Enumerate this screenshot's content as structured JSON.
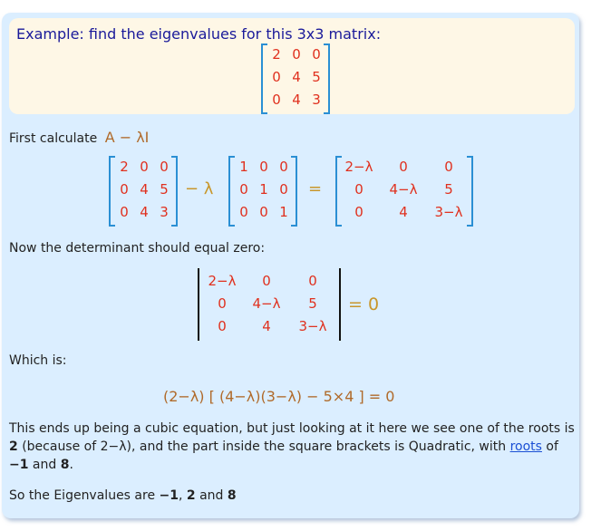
{
  "example": {
    "title": "Example: find the eigenvalues for this 3x3 matrix:",
    "matrix": [
      [
        "2",
        "0",
        "0"
      ],
      [
        "0",
        "4",
        "5"
      ],
      [
        "0",
        "4",
        "3"
      ]
    ]
  },
  "step1": {
    "intro": "First calculate",
    "expr": "A − λI",
    "left_matrix": [
      [
        "2",
        "0",
        "0"
      ],
      [
        "0",
        "4",
        "5"
      ],
      [
        "0",
        "4",
        "3"
      ]
    ],
    "minus_lambda": "− λ",
    "identity": [
      [
        "1",
        "0",
        "0"
      ],
      [
        "0",
        "1",
        "0"
      ],
      [
        "0",
        "0",
        "1"
      ]
    ],
    "equals": "=",
    "result": [
      [
        "2−λ",
        "0",
        "0"
      ],
      [
        "0",
        "4−λ",
        "5"
      ],
      [
        "0",
        "4",
        "3−λ"
      ]
    ]
  },
  "step2": {
    "intro": "Now the determinant should equal zero:",
    "det": [
      [
        "2−λ",
        "0",
        "0"
      ],
      [
        "0",
        "4−λ",
        "5"
      ],
      [
        "0",
        "4",
        "3−λ"
      ]
    ],
    "equals_zero": "= 0"
  },
  "step3": {
    "intro": "Which is:",
    "equation": "(2−λ) [ (4−λ)(3−λ) − 5×4 ] = 0"
  },
  "explanation": {
    "line1": "This ends up being a cubic equation, but just looking at it here we see one of the roots is",
    "l2_b1": "2",
    "l2_t1": " (because of 2−λ), and the part inside the square brackets is Quadratic, with ",
    "l2_link": "roots",
    "l2_t2": " of",
    "l3_b1": "−1",
    "l3_t1": " and ",
    "l3_b2": "8",
    "l3_t2": "."
  },
  "conclusion": {
    "t1": "So the Eigenvalues are ",
    "b1": "−1",
    "t2": ", ",
    "b2": "2",
    "t3": " and ",
    "b3": "8"
  }
}
